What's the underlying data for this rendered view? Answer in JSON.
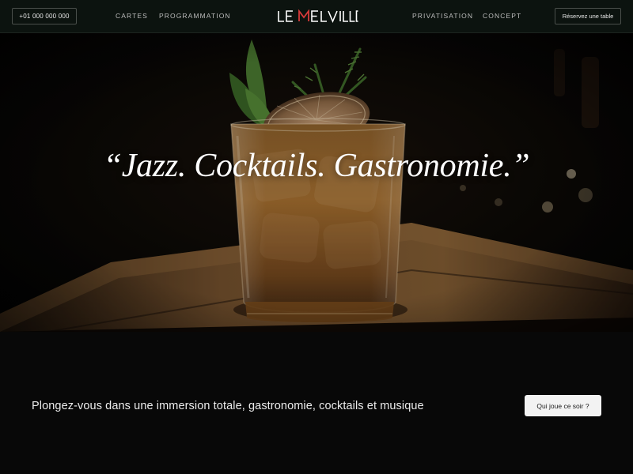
{
  "nav": {
    "phone": "+01 000 000 000",
    "links": {
      "cartes": "Cartes",
      "programmation": "Programmation",
      "privatisation": "Privatisation",
      "concept": "Concept"
    },
    "logo": "LE MELVILLE",
    "reserve_button": "Réservez une table"
  },
  "hero": {
    "quote": "“Jazz. Cocktails. Gastronomie.”"
  },
  "intro": {
    "tagline": "Plongez-vous dans une immersion totale, gastronomie, cocktails et musique",
    "button": "Qui joue ce soir ?"
  },
  "colors": {
    "nav_bg": "#0c130f",
    "page_bg": "#080808",
    "logo_accent": "#d63a3a",
    "button_bg": "#f3f3f3"
  }
}
